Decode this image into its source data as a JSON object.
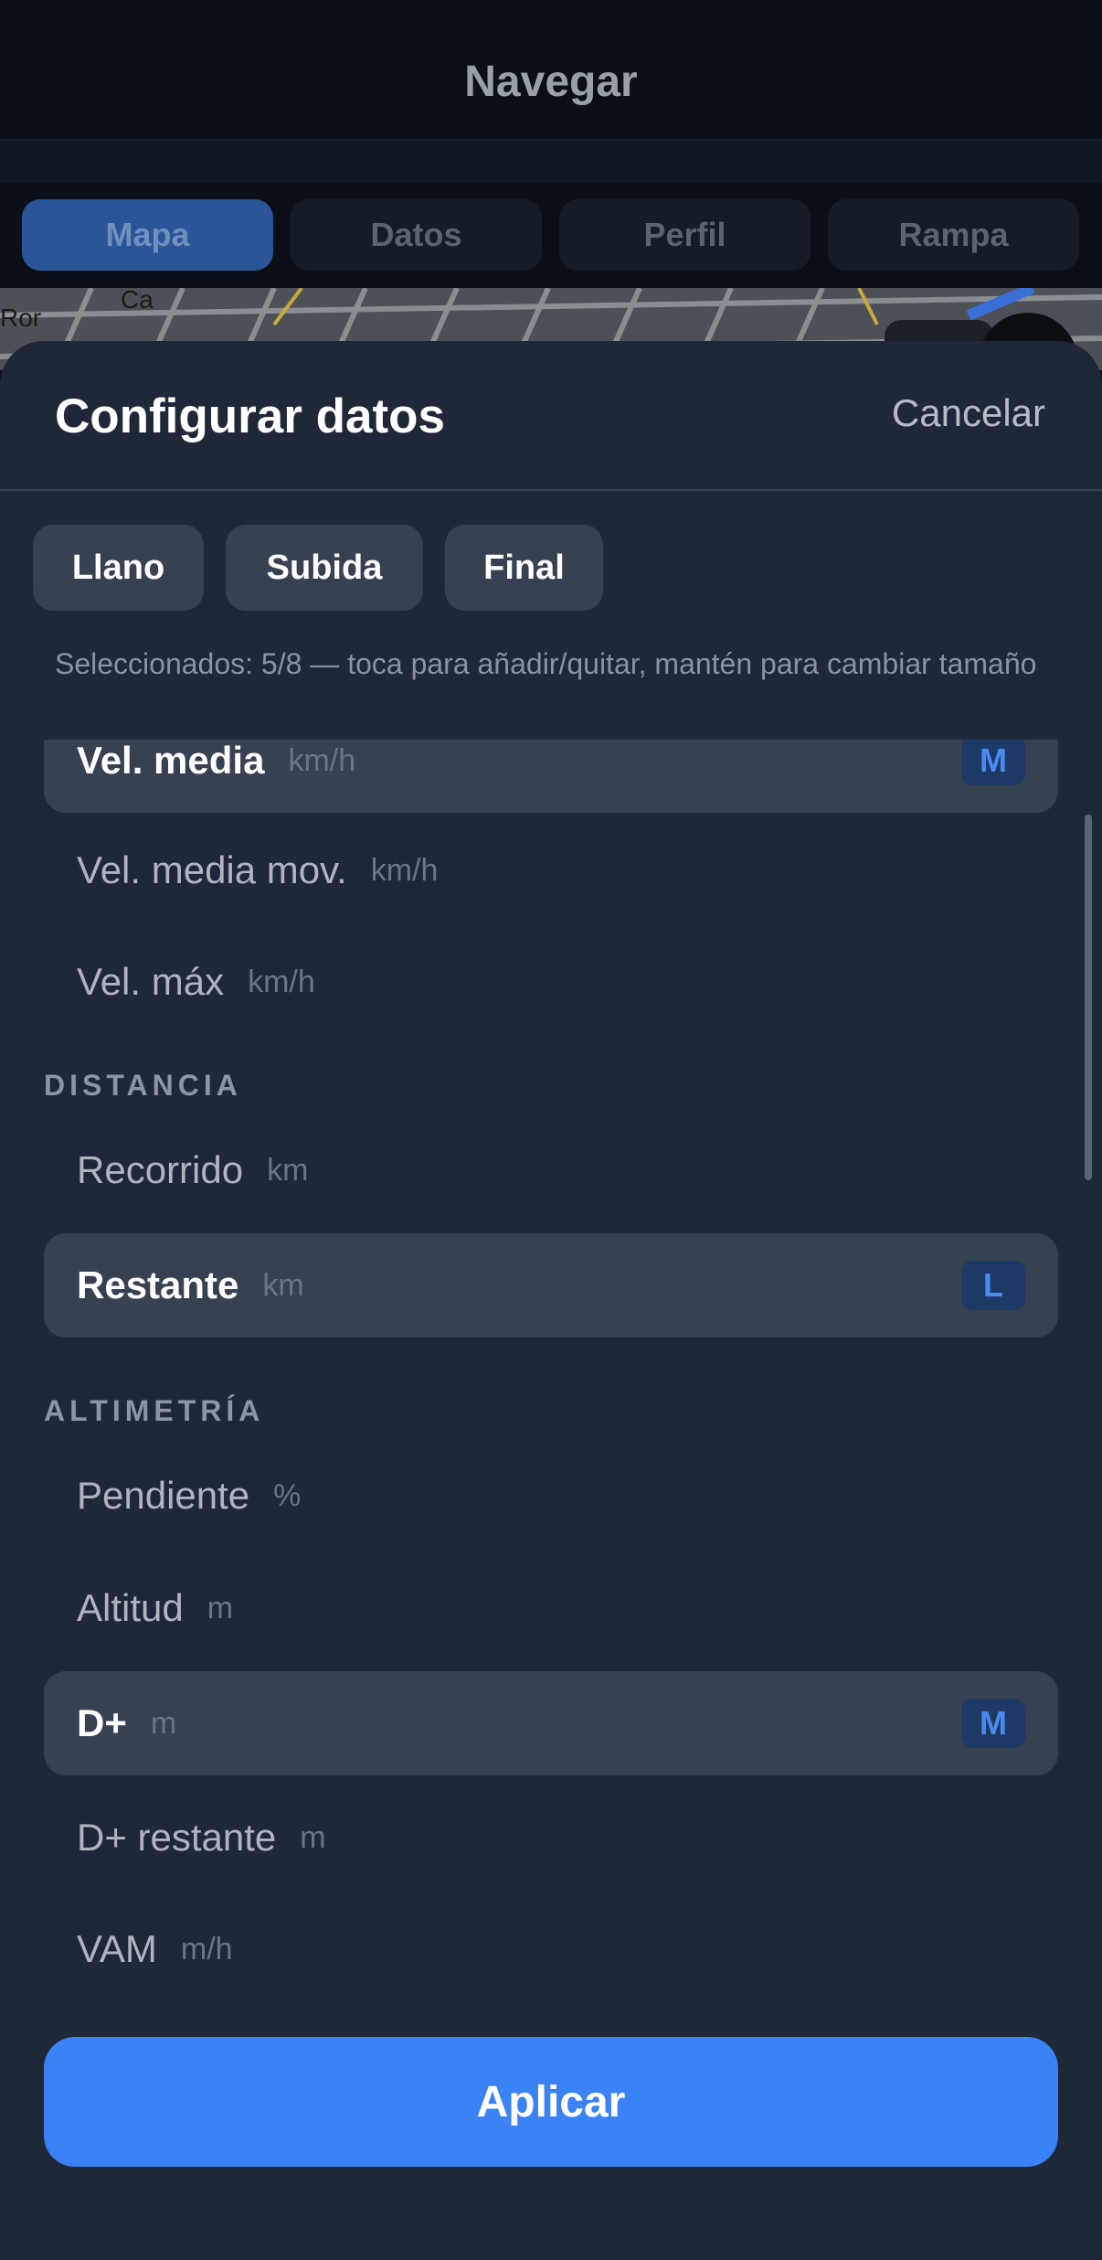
{
  "header": {
    "title": "Navegar"
  },
  "tabs": [
    {
      "label": "Mapa",
      "active": true
    },
    {
      "label": "Datos",
      "active": false
    },
    {
      "label": "Perfil",
      "active": false
    },
    {
      "label": "Rampa",
      "active": false
    }
  ],
  "map": {
    "street_label": "Ca",
    "street_label_2": "Ror"
  },
  "sheet": {
    "title": "Configurar datos",
    "cancel_label": "Cancelar",
    "presets": [
      "Llano",
      "Subida",
      "Final"
    ],
    "selection_info": "Seleccionados: 5/8 — toca para añadir/quitar, mantén para cambiar tamaño",
    "sections": [
      {
        "rows": [
          {
            "label": "Vel. media",
            "unit": "km/h",
            "selected": true,
            "size": "M"
          },
          {
            "label": "Vel. media mov.",
            "unit": "km/h",
            "selected": false
          },
          {
            "label": "Vel. máx",
            "unit": "km/h",
            "selected": false
          }
        ]
      },
      {
        "title": "DISTANCIA",
        "rows": [
          {
            "label": "Recorrido",
            "unit": "km",
            "selected": false
          },
          {
            "label": "Restante",
            "unit": "km",
            "selected": true,
            "size": "L"
          }
        ]
      },
      {
        "title": "ALTIMETRÍA",
        "rows": [
          {
            "label": "Pendiente",
            "unit": "%",
            "selected": false
          },
          {
            "label": "Altitud",
            "unit": "m",
            "selected": false
          },
          {
            "label": "D+",
            "unit": "m",
            "selected": true,
            "size": "M"
          },
          {
            "label": "D+ restante",
            "unit": "m",
            "selected": false
          },
          {
            "label": "VAM",
            "unit": "m/h",
            "selected": false
          }
        ]
      }
    ],
    "apply_label": "Aplicar"
  },
  "colors": {
    "accent": "#3b82f6",
    "sheet_bg": "#1f2838",
    "selected_row_bg": "#364152",
    "badge_bg": "#1d3a66",
    "badge_text": "#4a8af0"
  }
}
